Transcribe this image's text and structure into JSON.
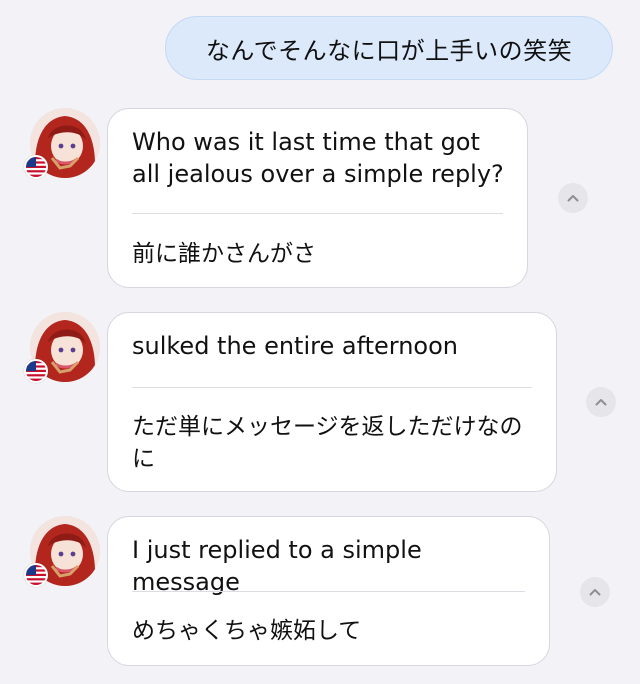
{
  "outgoing": {
    "text": "なんでそんなに口が上手いの笑笑"
  },
  "messages": [
    {
      "original": "Who was it last time that got all jealous over a simple reply?",
      "translation": "前に誰かさんがさ"
    },
    {
      "original": "sulked the entire afternoon",
      "translation": "ただ単にメッセージを返しただけなのに"
    },
    {
      "original": "I just replied to a simple message",
      "translation": "めちゃくちゃ嫉妬して"
    }
  ],
  "icons": {
    "avatar": "avatar-icon",
    "flag": "us-flag-icon",
    "collapse": "chevron-up-icon"
  },
  "colors": {
    "background": "#f2f2f7",
    "outgoing_bubble": "#dce9fb",
    "incoming_bubble": "#ffffff",
    "avatar_hair": "#b3261e"
  }
}
